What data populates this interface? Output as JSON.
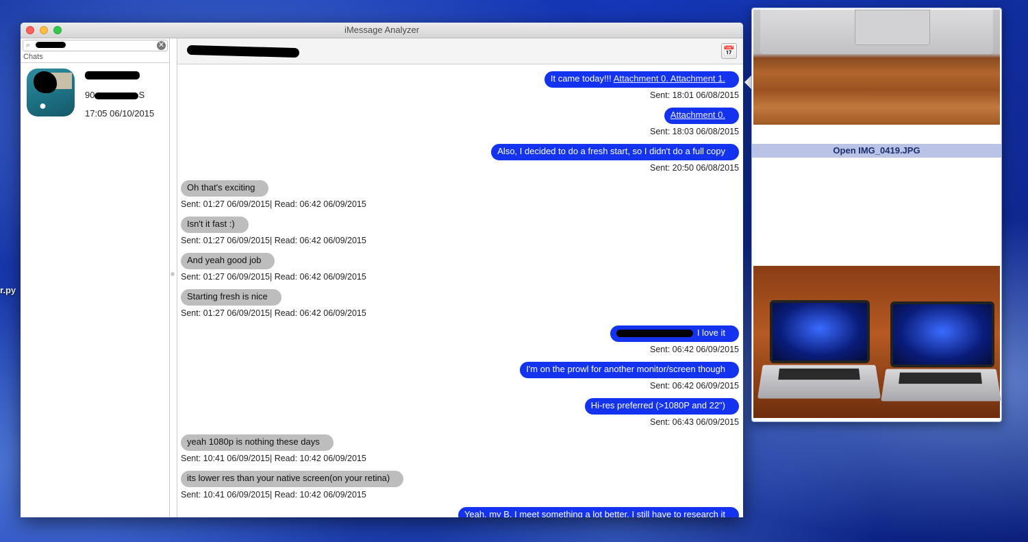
{
  "window": {
    "title": "iMessage Analyzer"
  },
  "desktop": {
    "file_label": "r.py"
  },
  "sidebar": {
    "search_icon": "magnifier-icon",
    "clear_icon": "✕",
    "chats_label": "Chats",
    "chat": {
      "number_prefix": "90",
      "number_suffix": "S",
      "time": "17:05 06/10/2015"
    }
  },
  "header": {
    "calendar_icon": "📅"
  },
  "messages": [
    {
      "dir": "sent",
      "text": "It came today!!! ",
      "links": "Attachment 0. Attachment 1.",
      "meta": "Sent: 18:01 06/08/2015"
    },
    {
      "dir": "sent",
      "text": "",
      "links": "Attachment 0.",
      "meta": "Sent: 18:03 06/08/2015"
    },
    {
      "dir": "sent",
      "text": "Also, I decided to do a fresh start, so I didn't do a full copy",
      "links": "",
      "meta": "Sent: 20:50 06/08/2015"
    },
    {
      "dir": "recv",
      "text": "Oh that's exciting",
      "links": "",
      "meta": "Sent: 01:27 06/09/2015| Read: 06:42 06/09/2015"
    },
    {
      "dir": "recv",
      "text": "Isn't it fast :)",
      "links": "",
      "meta": "Sent: 01:27 06/09/2015| Read: 06:42 06/09/2015"
    },
    {
      "dir": "recv",
      "text": "And yeah good job",
      "links": "",
      "meta": "Sent: 01:27 06/09/2015| Read: 06:42 06/09/2015"
    },
    {
      "dir": "recv",
      "text": "Starting fresh is nice",
      "links": "",
      "meta": "Sent: 01:27 06/09/2015| Read: 06:42 06/09/2015"
    },
    {
      "dir": "sent",
      "text": "I love it",
      "links": "",
      "meta": "Sent: 06:42 06/09/2015",
      "redacted": true
    },
    {
      "dir": "sent",
      "text": "I'm on the prowl for another monitor/screen though",
      "links": "",
      "meta": "Sent: 06:42 06/09/2015"
    },
    {
      "dir": "sent",
      "text": "Hi-res preferred (>1080P and 22\")",
      "links": "",
      "meta": "Sent: 06:43 06/09/2015"
    },
    {
      "dir": "recv",
      "text": "yeah 1080p is nothing these days",
      "links": "",
      "meta": "Sent: 10:41 06/09/2015| Read: 10:42 06/09/2015"
    },
    {
      "dir": "recv",
      "text": "its lower res than your native screen(on your retina)",
      "links": "",
      "meta": "Sent: 10:41 06/09/2015| Read: 10:42 06/09/2015"
    },
    {
      "dir": "sent",
      "text": "Yeah, my B. I meet something a lot better. I still have to research it",
      "links": "",
      "meta": ""
    }
  ],
  "preview": {
    "open_label": "Open IMG_0419.JPG"
  },
  "colors": {
    "sent_bubble": "#1433ee",
    "recv_bubble": "#bdbdbd",
    "open_bar": "#b9c3e6"
  }
}
